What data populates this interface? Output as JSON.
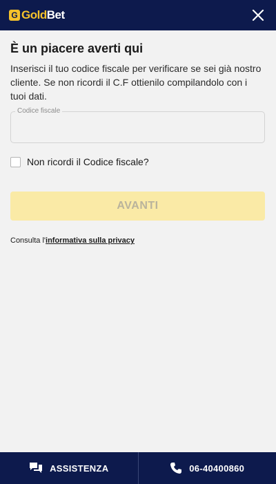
{
  "header": {
    "logo_badge": "G",
    "logo_gold": "Gold",
    "logo_bet": "Bet",
    "close_icon": "close-icon"
  },
  "main": {
    "title": "È un piacere averti qui",
    "description": "Inserisci il tuo codice fiscale per verificare se sei già nostro cliente. Se non ricordi il C.F ottienilo compilandolo con i tuoi dati.",
    "field_label": "Codice fiscale",
    "field_value": "",
    "checkbox_label": "Non ricordi il Codice fiscale?",
    "button_label": "AVANTI",
    "privacy_prefix": "Consulta l'",
    "privacy_link": "informativa sulla privacy"
  },
  "footer": {
    "assistance_label": "ASSISTENZA",
    "phone_label": "06-40400860"
  },
  "colors": {
    "navy": "#0d1a4d",
    "gold": "#f6c22b",
    "button_disabled": "#faeaa6"
  }
}
